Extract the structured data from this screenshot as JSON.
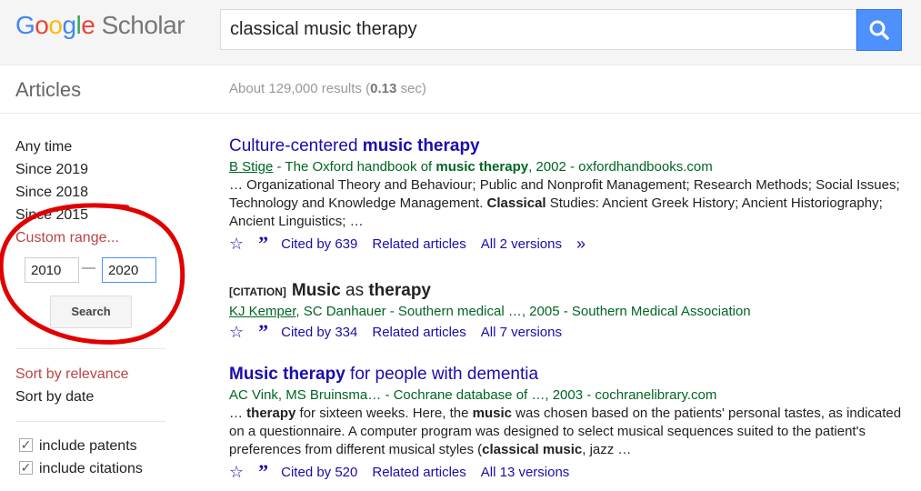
{
  "logo": {
    "g1": "G",
    "o1": "o",
    "o2": "o",
    "g2": "g",
    "l": "l",
    "e": "e",
    "suffix": " Scholar"
  },
  "search": {
    "query": "classical music therapy"
  },
  "subbar": {
    "section": "Articles",
    "results_prefix": "About 129,000 results (",
    "results_time": "0.13",
    "results_suffix": " sec)"
  },
  "sidebar": {
    "time_items": [
      "Any time",
      "Since 2019",
      "Since 2018",
      "Since 2015"
    ],
    "custom_range": "Custom range...",
    "year_from": "2010",
    "year_to": "2020",
    "dash": "—",
    "search_label": "Search",
    "sort_relevance": "Sort by relevance",
    "sort_date": "Sort by date",
    "include_patents": "include patents",
    "include_citations": "include citations"
  },
  "results": [
    {
      "title_pre": "Culture-centered ",
      "title_bold": "music therapy",
      "title_post": "",
      "author_link": "B Stige",
      "meta_rest_1": " - The Oxford handbook of ",
      "meta_bold": "music therapy",
      "meta_rest_2": ", 2002 - oxfordhandbooks.com",
      "snippet_1": "… Organizational Theory and Behaviour; Public and Nonprofit Management; Research Methods; Social Issues; Technology and Knowledge Management. ",
      "snippet_bold": "Classical",
      "snippet_2": " Studies: Ancient Greek History; Ancient Historiography; Ancient Linguistics; …",
      "cited": "Cited by 639",
      "related": "Related articles",
      "versions": "All 2 versions"
    },
    {
      "tag": "[CITATION]",
      "title_bold_1": "Music",
      "title_mid": " as ",
      "title_bold_2": "therapy",
      "author_link": "KJ Kemper",
      "meta_rest": ", SC Danhauer - Southern medical …, 2005 - Southern Medical Association",
      "cited": "Cited by 334",
      "related": "Related articles",
      "versions": "All 7 versions"
    },
    {
      "title_bold": "Music therapy",
      "title_post": " for people with dementia",
      "meta": "AC Vink, MS Bruinsma… - Cochrane database of …, 2003 - cochranelibrary.com",
      "snip_a": "… ",
      "snip_b": "therapy",
      "snip_c": " for sixteen weeks. Here, the ",
      "snip_d": "music",
      "snip_e": " was chosen based on the patients' personal tastes, as indicated on a questionnaire. A computer program was designed to select musical sequences suited to the patient's preferences from different musical styles (",
      "snip_f": "classical music",
      "snip_g": ", jazz …",
      "cited": "Cited by 520",
      "related": "Related articles",
      "versions": "All 13 versions"
    }
  ],
  "colors": {
    "accent": "#4d90fe",
    "link": "#1a0dab",
    "meta_green": "#006621",
    "annotation_red": "#e00000"
  }
}
